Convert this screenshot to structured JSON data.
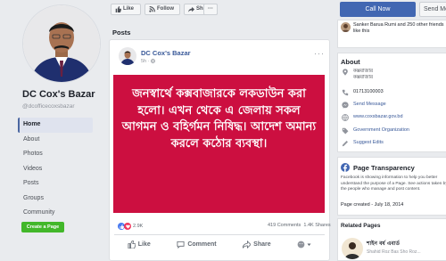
{
  "page": {
    "name": "DC Cox's Bazar",
    "handle": "@dcofficecoxsbazar"
  },
  "nav": {
    "items": [
      "Home",
      "About",
      "Photos",
      "Videos",
      "Posts",
      "Groups",
      "Community"
    ],
    "active_index": 0,
    "create_page_label": "Create a Page"
  },
  "action_bar": {
    "like": "Like",
    "follow": "Follow",
    "share": "Share",
    "more": "···"
  },
  "buttons": {
    "call": "Call Now",
    "message": "Send Me"
  },
  "posts_section": {
    "title": "Posts"
  },
  "post": {
    "author": "DC Cox's Bazar",
    "time": "5h ·",
    "menu": "···",
    "image_text": "জনস্বার্থে কক্সবাজারকে লকডাউন করা হলো। এখন থেকে এ জেলায় সকল আগমন ও বহির্গমন নিষিদ্ধ। আদেশ অমান্য করলে কঠোর ব্যবস্থা।",
    "reactions_count": "2.9K",
    "comments_count": "419 Comments",
    "shares_count": "1.4K Shares",
    "actions": [
      "Like",
      "Comment",
      "Share"
    ]
  },
  "right": {
    "liked_by_text": "Sanker Barua Rumi and 250 other friends like this",
    "about": {
      "title": "About",
      "address_line1": "কক্সবাজার",
      "address_line2": "কক্সবাজার",
      "phone": "01713100003",
      "send_message": "Send Message",
      "website": "www.coxsbazar.gov.bd",
      "category": "Government Organization",
      "suggest_edits": "Suggest Edits"
    },
    "transparency": {
      "title": "Page Transparency",
      "text": "Facebook is showing information to help you better understand the purpose of a Page. See actions taken by the people who manage and post content.",
      "created": "Page created - July 18, 2014"
    },
    "related": {
      "title": "Related Pages",
      "name": "শাইন বর্ধ এবার্ড",
      "sub": "Shahid Roz Bas Sho Roz..."
    }
  },
  "colors": {
    "fb_blue": "#4267b2",
    "link": "#385898",
    "post_bg": "#cc0f40",
    "green": "#42b72a"
  }
}
